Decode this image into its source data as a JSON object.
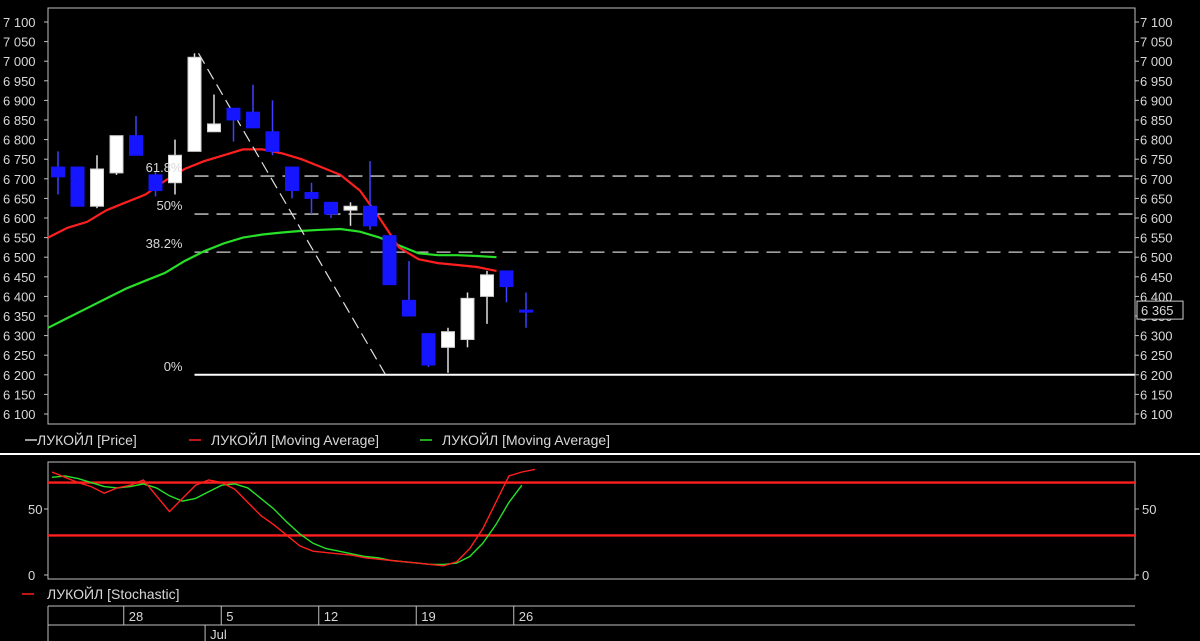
{
  "chart_data": {
    "type": "candlestick",
    "title": "",
    "price_panel": {
      "ylim": [
        6070,
        7120
      ],
      "yticks": [
        6100,
        6150,
        6200,
        6250,
        6300,
        6350,
        6400,
        6450,
        6500,
        6550,
        6600,
        6650,
        6700,
        6750,
        6800,
        6850,
        6900,
        6950,
        7000,
        7050,
        7100
      ],
      "ytick_labels": [
        "6 100",
        "6 150",
        "6 200",
        "6 250",
        "6 300",
        "6 350",
        "6 400",
        "6 450",
        "6 500",
        "6 550",
        "6 600",
        "6 650",
        "6 700",
        "6 750",
        "6 800",
        "6 850",
        "6 900",
        "6 950",
        "7 000",
        "7 050",
        "7 100"
      ],
      "last_price_label": "6 365",
      "last_price": 6365,
      "candles": [
        {
          "o": 6730,
          "h": 6770,
          "l": 6660,
          "c": 6705,
          "dir": "down"
        },
        {
          "o": 6730,
          "h": 6730,
          "l": 6630,
          "c": 6630,
          "dir": "down"
        },
        {
          "o": 6630,
          "h": 6760,
          "l": 6625,
          "c": 6725,
          "dir": "up"
        },
        {
          "o": 6715,
          "h": 6810,
          "l": 6710,
          "c": 6810,
          "dir": "up"
        },
        {
          "o": 6810,
          "h": 6860,
          "l": 6760,
          "c": 6760,
          "dir": "down"
        },
        {
          "o": 6710,
          "h": 6720,
          "l": 6655,
          "c": 6670,
          "dir": "down"
        },
        {
          "o": 6690,
          "h": 6800,
          "l": 6660,
          "c": 6760,
          "dir": "up"
        },
        {
          "o": 6770,
          "h": 7020,
          "l": 6770,
          "c": 7010,
          "dir": "up"
        },
        {
          "o": 6820,
          "h": 6915,
          "l": 6820,
          "c": 6840,
          "dir": "up"
        },
        {
          "o": 6880,
          "h": 6880,
          "l": 6795,
          "c": 6850,
          "dir": "down"
        },
        {
          "o": 6870,
          "h": 6940,
          "l": 6830,
          "c": 6830,
          "dir": "down"
        },
        {
          "o": 6820,
          "h": 6900,
          "l": 6760,
          "c": 6770,
          "dir": "down"
        },
        {
          "o": 6730,
          "h": 6730,
          "l": 6650,
          "c": 6670,
          "dir": "down"
        },
        {
          "o": 6665,
          "h": 6690,
          "l": 6610,
          "c": 6650,
          "dir": "down"
        },
        {
          "o": 6640,
          "h": 6640,
          "l": 6600,
          "c": 6610,
          "dir": "down"
        },
        {
          "o": 6630,
          "h": 6640,
          "l": 6580,
          "c": 6620,
          "dir": "up"
        },
        {
          "o": 6630,
          "h": 6745,
          "l": 6570,
          "c": 6580,
          "dir": "down"
        },
        {
          "o": 6555,
          "h": 6555,
          "l": 6430,
          "c": 6430,
          "dir": "down"
        },
        {
          "o": 6390,
          "h": 6490,
          "l": 6355,
          "c": 6350,
          "dir": "down"
        },
        {
          "o": 6305,
          "h": 6305,
          "l": 6220,
          "c": 6225,
          "dir": "down"
        },
        {
          "o": 6270,
          "h": 6320,
          "l": 6205,
          "c": 6310,
          "dir": "up"
        },
        {
          "o": 6290,
          "h": 6410,
          "l": 6270,
          "c": 6395,
          "dir": "up"
        },
        {
          "o": 6400,
          "h": 6465,
          "l": 6330,
          "c": 6455,
          "dir": "up"
        },
        {
          "o": 6465,
          "h": 6465,
          "l": 6385,
          "c": 6425,
          "dir": "down"
        },
        {
          "o": 6365,
          "h": 6410,
          "l": 6320,
          "c": 6365,
          "dir": "down"
        }
      ],
      "ma_red": [
        6550,
        6575,
        6590,
        6620,
        6640,
        6660,
        6695,
        6725,
        6745,
        6760,
        6775,
        6775,
        6765,
        6750,
        6730,
        6710,
        6670,
        6600,
        6525,
        6495,
        6485,
        6480,
        6475,
        6465
      ],
      "ma_green": [
        6320,
        6345,
        6370,
        6395,
        6420,
        6440,
        6460,
        6490,
        6515,
        6535,
        6550,
        6558,
        6563,
        6567,
        6570,
        6572,
        6565,
        6550,
        6530,
        6510,
        6505,
        6505,
        6503,
        6500
      ],
      "trendline": {
        "from_index": 7,
        "from_price": 7020,
        "to_index": 16.8,
        "to_price": 6200
      },
      "fibonacci": [
        {
          "label": "61.8%",
          "price": 6707
        },
        {
          "label": "50%",
          "price": 6610
        },
        {
          "label": "38.2%",
          "price": 6513
        },
        {
          "label": "0%",
          "price": 6200
        }
      ]
    },
    "legend": [
      {
        "name": "ЛУКОЙЛ [Price]",
        "color": "#d0d0d0"
      },
      {
        "name": "ЛУКОЙЛ [Moving Average]",
        "color": "#ff1f1f"
      },
      {
        "name": "ЛУКОЙЛ [Moving Average]",
        "color": "#27e027"
      }
    ],
    "stochastic_panel": {
      "ylim": [
        -3,
        88
      ],
      "yticks": [
        0,
        50
      ],
      "ytick_labels": [
        "0",
        "50"
      ],
      "levels": [
        70,
        30
      ],
      "k_red": [
        78,
        74,
        70,
        67,
        62,
        66,
        68,
        72,
        60,
        48,
        58,
        68,
        72,
        70,
        65,
        55,
        45,
        38,
        30,
        22,
        18,
        17,
        16,
        15,
        13,
        12,
        11,
        10,
        9,
        8,
        7,
        10,
        20,
        35,
        55,
        75,
        78,
        80
      ],
      "d_green": [
        74,
        75,
        73,
        70,
        67,
        66,
        67,
        69,
        66,
        60,
        56,
        58,
        63,
        68,
        69,
        66,
        58,
        50,
        40,
        31,
        24,
        20,
        18,
        16,
        14,
        13,
        11,
        10,
        9,
        8,
        8,
        9,
        14,
        24,
        38,
        55,
        68
      ],
      "legend": {
        "name": "ЛУКОЙЛ [Stochastic]",
        "color": "#ff1f1f"
      }
    },
    "x_axis": {
      "date_labels": [
        {
          "label": "28",
          "index": 4.5
        },
        {
          "label": "5",
          "index": 9.5
        },
        {
          "label": "12",
          "index": 14.5
        },
        {
          "label": "19",
          "index": 19.5
        },
        {
          "label": "26",
          "index": 24.5
        }
      ],
      "month_labels": [
        {
          "label": "Jul",
          "index": 7.8
        }
      ]
    }
  }
}
